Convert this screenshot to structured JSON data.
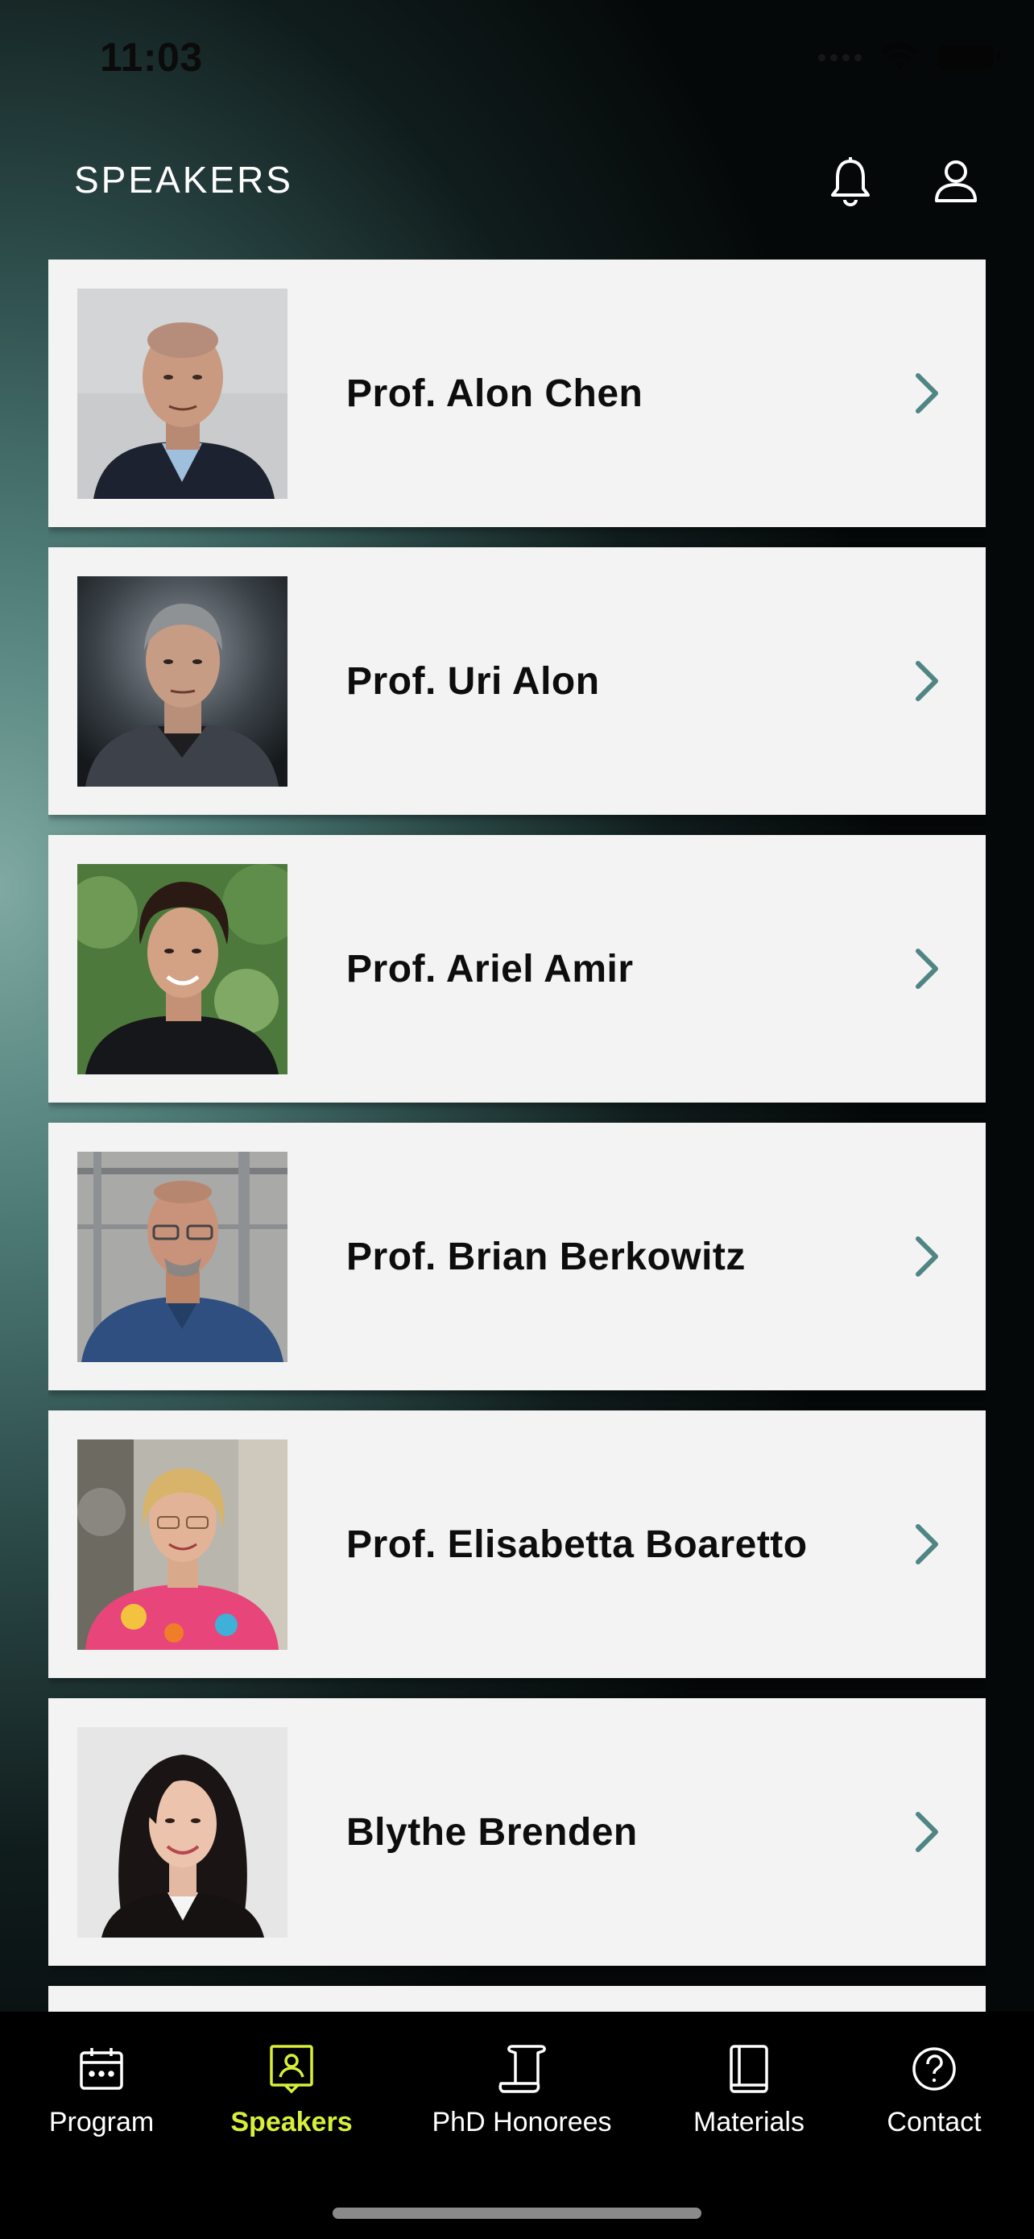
{
  "status_bar": {
    "time": "11:03"
  },
  "header": {
    "title": "SPEAKERS",
    "bell_icon": "bell-icon",
    "profile_icon": "person-icon"
  },
  "speakers": [
    {
      "name": "Prof. Alon Chen",
      "photo": "portrait-bald-man-grey-background"
    },
    {
      "name": "Prof. Uri Alon",
      "photo": "portrait-grey-haired-man-dark-background"
    },
    {
      "name": "Prof. Ariel Amir",
      "photo": "portrait-curly-haired-man-green-background"
    },
    {
      "name": "Prof. Brian Berkowitz",
      "photo": "portrait-man-glasses-lab-background"
    },
    {
      "name": "Prof. Elisabetta Boaretto",
      "photo": "portrait-woman-floral-shirt-lab-background"
    },
    {
      "name": "Blythe Brenden",
      "photo": "portrait-dark-haired-woman-white-background"
    }
  ],
  "tabs": [
    {
      "label": "Program",
      "icon": "calendar-icon",
      "active": false
    },
    {
      "label": "Speakers",
      "icon": "speaker-badge-icon",
      "active": true
    },
    {
      "label": "PhD Honorees",
      "icon": "scroll-icon",
      "active": false
    },
    {
      "label": "Materials",
      "icon": "book-icon",
      "active": false
    },
    {
      "label": "Contact",
      "icon": "help-icon",
      "active": false
    }
  ],
  "colors": {
    "accent": "#d8ef3a",
    "chevron": "#4f8583",
    "card_bg": "#f3f3f3",
    "tabbar_bg": "#000000"
  }
}
